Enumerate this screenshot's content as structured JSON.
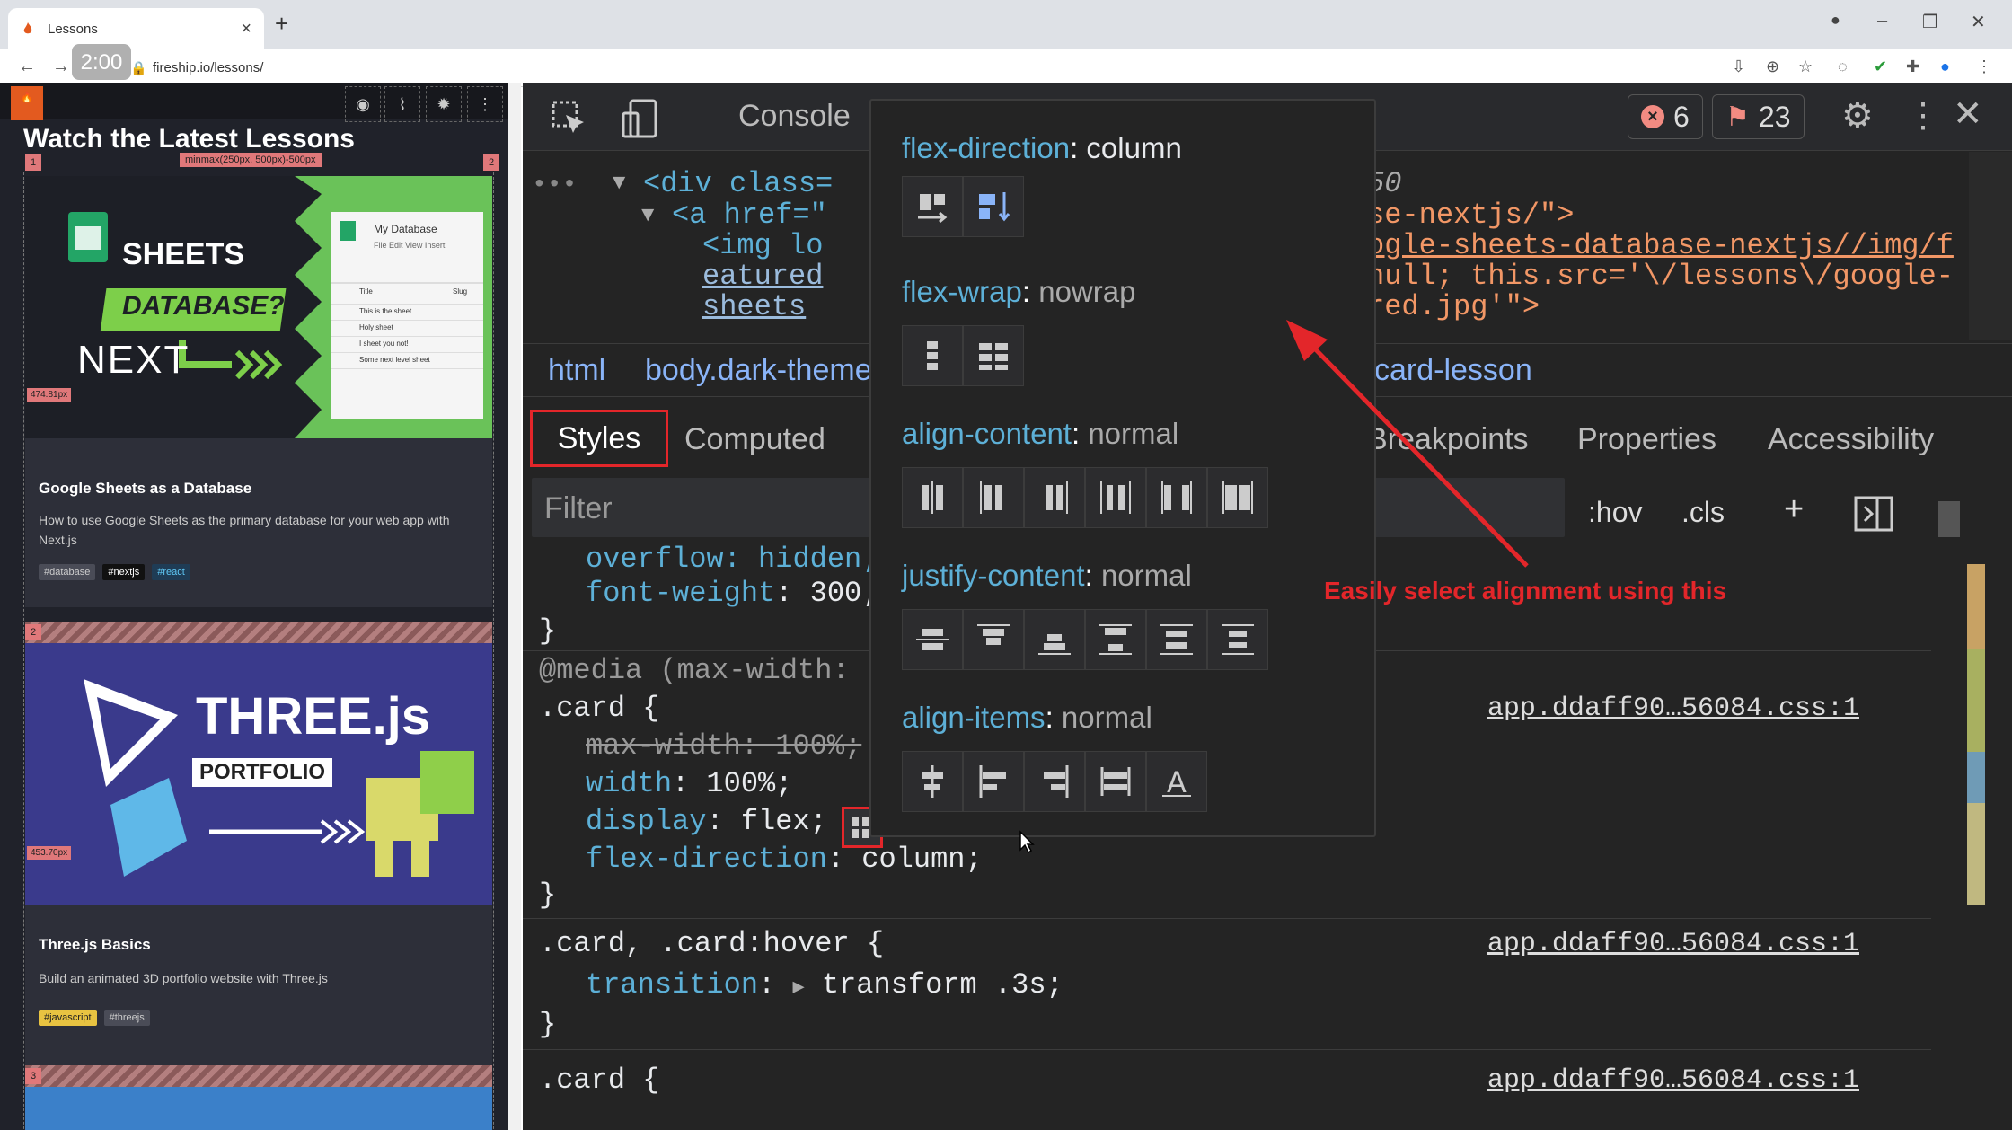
{
  "browser": {
    "tab_title": "Lessons",
    "url": "fireship.io/lessons/",
    "timer": "2:00"
  },
  "site": {
    "page_title": "Watch the Latest Lessons",
    "minmax_label": "minmax(250px, 500px)-500px",
    "gutter_left": "1",
    "gutter_right": "2",
    "row_label_1": "1",
    "row_label_2": "2",
    "row_label_3": "3",
    "cards": [
      {
        "title": "Google Sheets as a Database",
        "desc": "How to use Google Sheets as the primary database for your web app with Next.js",
        "tags": [
          "#database",
          "#nextjs",
          "#react"
        ],
        "height_label": "474.81px",
        "thumb_text1": "SHEETS",
        "thumb_text2": "DATABASE?",
        "thumb_text3": "NEXT",
        "sheet_title": "My Database",
        "sheet_menu": "File  Edit  View  Insert",
        "sheet_rows": [
          "Title",
          "Slug",
          "This is the sheet",
          "Holy sheet",
          "I sheet you not!",
          "Some next level sheet"
        ]
      },
      {
        "title": "Three.js Basics",
        "desc": "Build an animated 3D portfolio website with Three.js",
        "tags": [
          "#javascript",
          "#threejs"
        ],
        "height_label": "453.70px",
        "thumb_text1": "THREE.js",
        "thumb_text2": "PORTFOLIO"
      }
    ]
  },
  "devtools": {
    "tab_console": "Console",
    "error_count": "6",
    "issue_count": "23",
    "elements_lines": {
      "l1a": "<div class=",
      "l1b": "50",
      "l2a": "<a href=\"",
      "l2b": "se-nextjs/\">",
      "l3a": "<img lo",
      "l3b": "ogle-sheets-database-nextjs//img/f",
      "l4a": "eatured",
      "l4b": "null; this.src='\\/lessons\\/google-",
      "l5a": "sheets",
      "l5b": "red.jpg'\">"
    },
    "breadcrumb": [
      "html",
      "body.dark-theme",
      "card-lesson"
    ],
    "style_tabs": [
      "Styles",
      "Computed",
      "Breakpoints",
      "Properties",
      "Accessibility"
    ],
    "filter_placeholder": "Filter",
    "hov": ":hov",
    "cls": ".cls",
    "css_lines": {
      "overflow": "overflow: hidden;",
      "font_weight_prop": "font-weight",
      "font_weight_val": "300;",
      "brace": "}",
      "media": "@media (max-width: 7",
      "card_sel": ".card {",
      "max_width": "max-width: 100%;",
      "width_prop": "width",
      "width_val": "100%;",
      "display_prop": "display",
      "display_val": "flex;",
      "fd_prop": "flex-direction",
      "fd_val": "column;",
      "hover_sel": ".card, .card:hover {",
      "transition_prop": "transition",
      "transition_val": "transform .3s;",
      "card_sel2": ".card {",
      "src1": "app.ddaff90…56084.css:1",
      "src2": "app.ddaff90…56084.css:1",
      "src3": "app.ddaff90…56084.css:1"
    },
    "flex_editor": {
      "flex_direction": {
        "name": "flex-direction",
        "value": "column"
      },
      "flex_wrap": {
        "name": "flex-wrap",
        "value": "nowrap"
      },
      "align_content": {
        "name": "align-content",
        "value": "normal"
      },
      "justify_content": {
        "name": "justify-content",
        "value": "normal"
      },
      "align_items": {
        "name": "align-items",
        "value": "normal"
      }
    }
  },
  "annotation": {
    "text": "Easily select alignment using this",
    "color": "#e3262a"
  },
  "colors": {
    "accent_red": "#e3262a",
    "devtools_blue": "#5db0d7",
    "selected_icon_blue": "#8ab4f8"
  }
}
